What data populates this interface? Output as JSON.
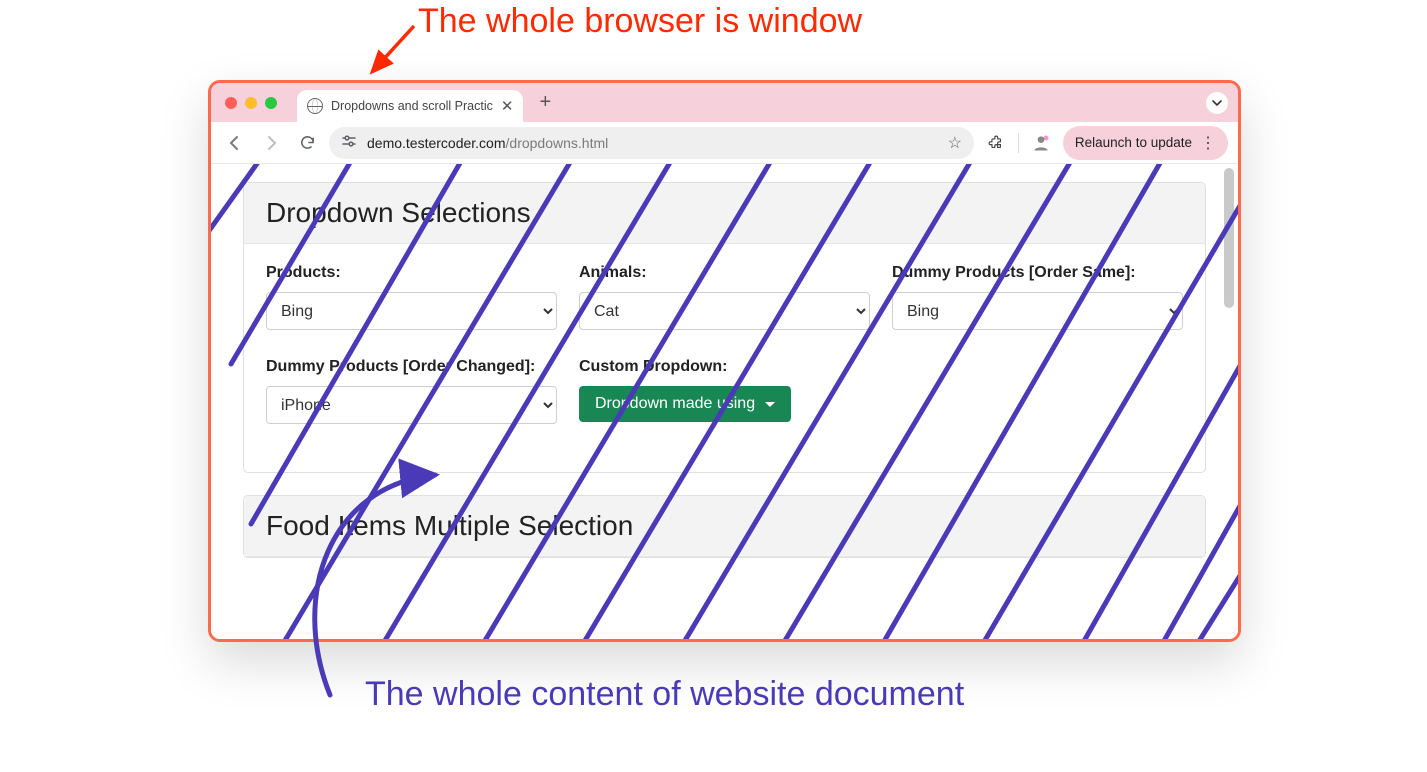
{
  "annotations": {
    "top_text": "The whole browser is window",
    "bottom_text": "The whole content of website document"
  },
  "browser": {
    "tab_title": "Dropdowns and scroll Practic",
    "url_host": "demo.testercoder.com",
    "url_path": "/dropdowns.html",
    "relaunch_label": "Relaunch to update"
  },
  "page": {
    "card1_title": "Dropdown Selections",
    "card2_title": "Food Items Multiple Selection",
    "labels": {
      "products": "Products:",
      "animals": "Animals:",
      "dummy_same": "Dummy Products [Order Same]:",
      "dummy_changed": "Dummy Products [Order Changed]:",
      "custom": "Custom Dropdown:"
    },
    "values": {
      "products": "Bing",
      "animals": "Cat",
      "dummy_same": "Bing",
      "dummy_changed": "iPhone",
      "custom_button": "Dropdown made using"
    }
  }
}
